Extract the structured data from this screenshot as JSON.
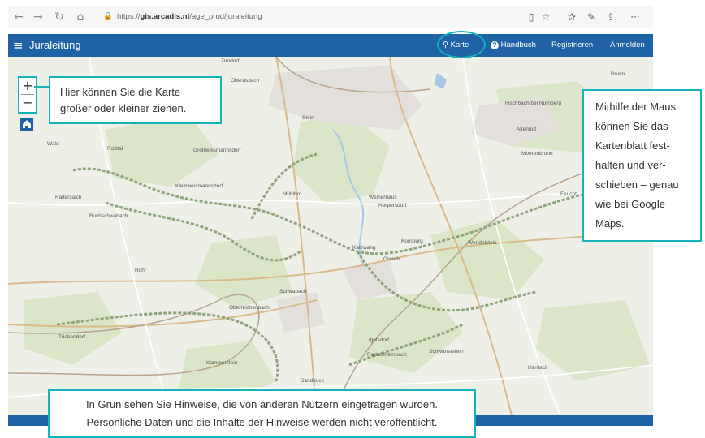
{
  "browser": {
    "url_prefix": "https://",
    "url_host": "gis.arcadis.nl",
    "url_path": "/age_prod/juraleitung",
    "icons": [
      "back-icon",
      "forward-icon",
      "refresh-icon",
      "home-icon",
      "lock-icon",
      "reading-view-icon",
      "favorite-icon",
      "favorites-bar-icon",
      "pen-icon",
      "share-icon",
      "more-icon"
    ]
  },
  "app": {
    "title": "Juraleitung",
    "nav": {
      "map": "Karte",
      "manual": "Handbuch",
      "register": "Registrieren",
      "login": "Anmelden"
    }
  },
  "map_controls": {
    "zoom_in": "+",
    "zoom_out": "−"
  },
  "map_labels": {
    "zirndorf": "Zirndorf",
    "oberasbach": "Oberasbach",
    "stein": "Stein",
    "rosstal": "Roßtal",
    "grossweismannsdorf": "Großweismannsdorf",
    "kleinweismannsdorf": "Kleinweismannsdorf",
    "raitersaich": "Raitersaich",
    "buchschwabach": "Buchschwabach",
    "muehlhof": "Mühlhof",
    "weiherhaus": "Weiherhaus",
    "herpersdorf": "Herpersdorf",
    "katzwang": "Katzwang",
    "kornburg": "Kornburg",
    "wendelstein": "Wendelstein",
    "greuth": "Greuth",
    "rohr": "Rohr",
    "schwabach": "Schwabach",
    "oberreichenbach": "Oberreichenbach",
    "triebendorf": "Triebendorf",
    "igelsdorf": "Igelsdorf",
    "rednitzhembach": "Rednitzhembach",
    "schwanstetten": "Schwanstetten",
    "kammerstein": "Kammerstein",
    "fischbach": "Fischbach bei Nürnberg",
    "altenfurt": "Altenfurt",
    "moorenbrunn": "Moorenbrunn",
    "feucht": "Feucht",
    "brunn": "Brunn",
    "harrlach": "Harrlach",
    "sandbuck": "Sandbuck",
    "wald": "Wald"
  },
  "callouts": {
    "zoom": "Hier können Sie die Karte größer oder kleiner ziehen.",
    "drag": "Mithilfe der Maus können Sie das Kartenblatt fest­halten und ver­schieben – genau wie bei Google Maps.",
    "notes": "In Grün sehen Sie Hinweise, die von anderen Nutzern eingetragen wurden. Persönliche Daten und die Inhalte der Hinweise werden nicht veröffentlicht."
  },
  "colors": {
    "accent": "#14b3bc",
    "appbar": "#1f63a6"
  }
}
